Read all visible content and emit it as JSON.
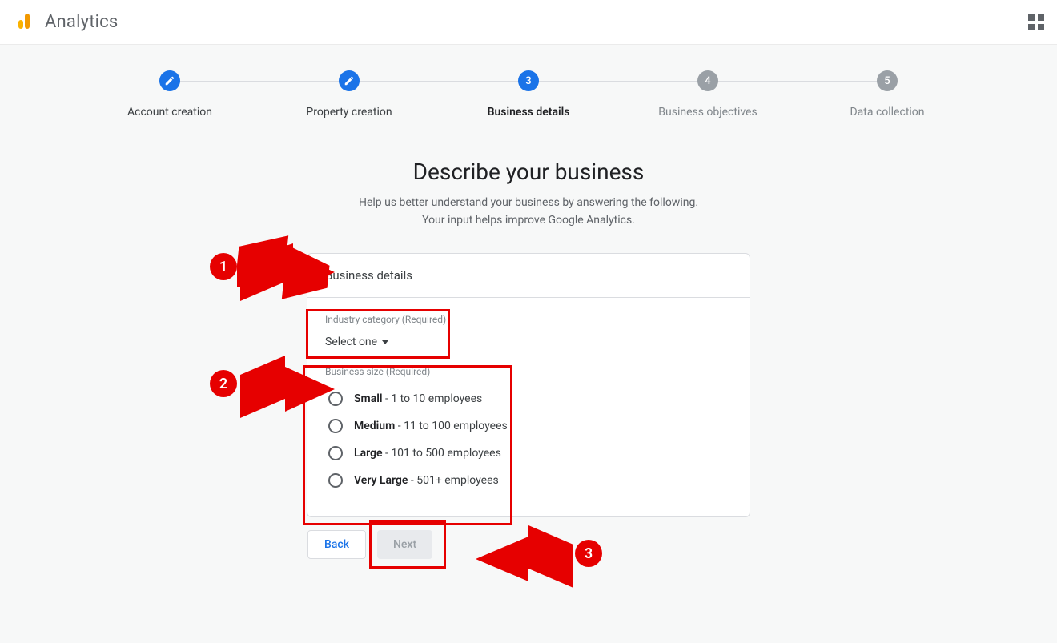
{
  "header": {
    "product_name": "Analytics"
  },
  "stepper": {
    "steps": [
      {
        "label": "Account creation",
        "state": "done",
        "icon": "pencil"
      },
      {
        "label": "Property creation",
        "state": "done",
        "icon": "pencil"
      },
      {
        "label": "Business details",
        "state": "current",
        "number": "3"
      },
      {
        "label": "Business objectives",
        "state": "future",
        "number": "4"
      },
      {
        "label": "Data collection",
        "state": "future",
        "number": "5"
      }
    ]
  },
  "heading": {
    "title": "Describe your business",
    "sub_line1": "Help us better understand your business by answering the following.",
    "sub_line2": "Your input helps improve Google Analytics."
  },
  "card": {
    "title": "Business details",
    "industry": {
      "label": "Industry category (Required)",
      "selected": "Select one"
    },
    "size": {
      "label": "Business size (Required)",
      "options": [
        {
          "strong": "Small",
          "rest": " - 1 to 10 employees"
        },
        {
          "strong": "Medium",
          "rest": " - 11 to 100 employees"
        },
        {
          "strong": "Large",
          "rest": " - 101 to 500 employees"
        },
        {
          "strong": "Very Large",
          "rest": " - 501+ employees"
        }
      ]
    }
  },
  "buttons": {
    "back": "Back",
    "next": "Next"
  },
  "annotations": {
    "n1": "1",
    "n2": "2",
    "n3": "3"
  }
}
